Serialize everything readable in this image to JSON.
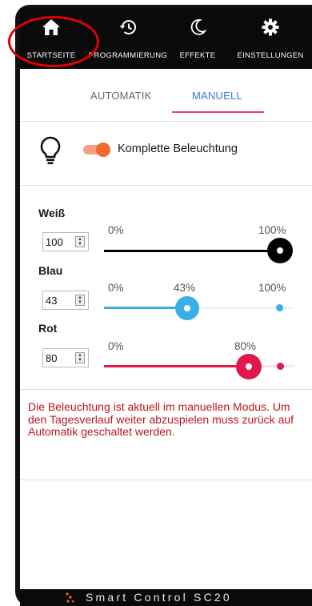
{
  "nav": {
    "items": [
      {
        "label": "STARTSEITE",
        "icon": "home-icon"
      },
      {
        "label": "PROGRAMMIERUNG",
        "icon": "history-icon"
      },
      {
        "label": "EFFEKTE",
        "icon": "moon-icon"
      },
      {
        "label": "EINSTELLUNGEN",
        "icon": "gear-icon"
      }
    ]
  },
  "tabs": {
    "automatic": "AUTOMATIK",
    "manual": "MANUELL"
  },
  "lighting": {
    "label": "Komplette Beleuchtung",
    "toggle_on": true,
    "toggle_color": "#f26a30"
  },
  "channels": [
    {
      "name": "Weiß",
      "value": "100",
      "min_label": "0%",
      "current_label": "",
      "max_label": "100%",
      "level": 1.0,
      "color": "#000000"
    },
    {
      "name": "Blau",
      "value": "43",
      "min_label": "0%",
      "current_label": "43%",
      "max_label": "100%",
      "level": 0.43,
      "color": "#3aaee6"
    },
    {
      "name": "Rot",
      "value": "80",
      "min_label": "0%",
      "current_label": "80%",
      "max_label": "",
      "level": 0.8,
      "color": "#e0194a"
    }
  ],
  "message": "Die Beleuchtung ist aktuell im manuellen Modus. Um den Tagesverlauf weiter abzuspielen muss zurück auf Automatik geschaltet werden.",
  "footer": {
    "brand": "Smart Control SC20"
  }
}
